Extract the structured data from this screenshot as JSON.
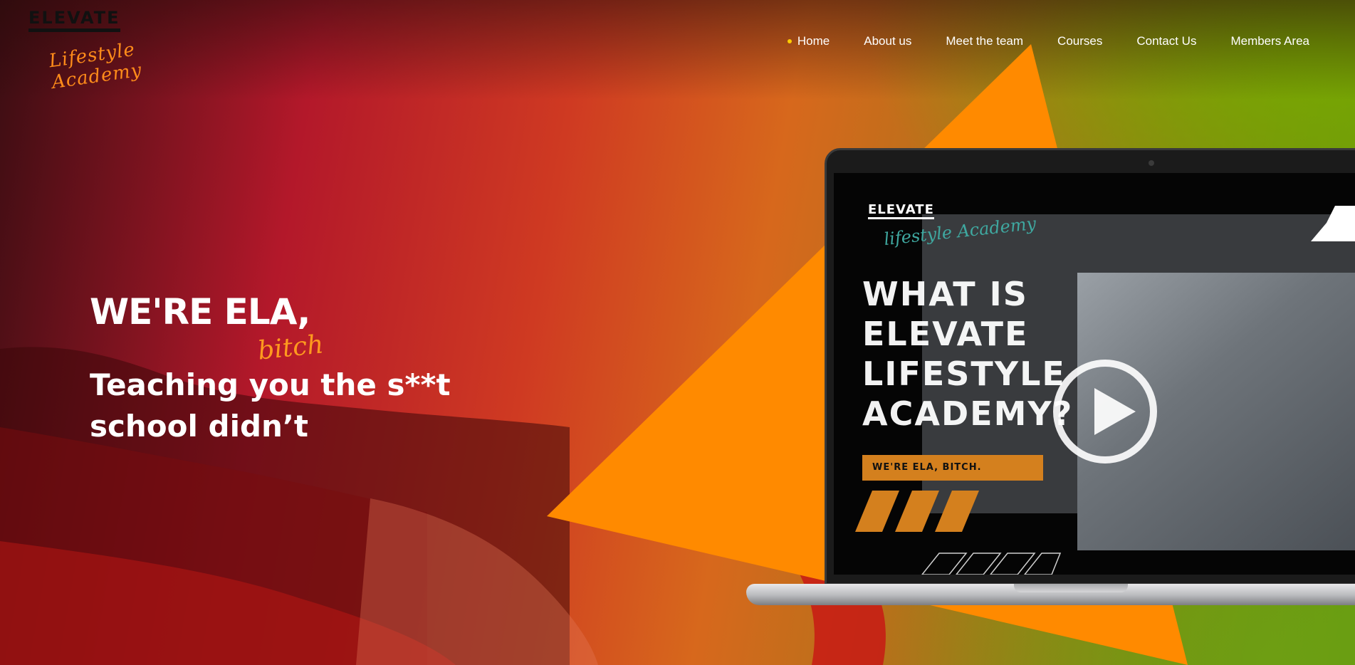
{
  "logo": {
    "wordmark": "ELEVATE",
    "script": "Lifestyle Academy"
  },
  "nav": {
    "items": [
      {
        "label": "Home",
        "active": true
      },
      {
        "label": "About us",
        "active": false
      },
      {
        "label": "Meet the team",
        "active": false
      },
      {
        "label": "Courses",
        "active": false
      },
      {
        "label": "Contact Us",
        "active": false
      },
      {
        "label": "Members Area",
        "active": false
      }
    ]
  },
  "hero": {
    "headline": "WE'RE ELA,",
    "script": "bitch",
    "subline_1": "Teaching you the s**t",
    "subline_2": "school didn’t"
  },
  "video": {
    "logo_word": "ELEVATE",
    "logo_script": "lifestyle Academy",
    "title_1": "WHAT IS",
    "title_2": "ELEVATE",
    "title_3": "LIFESTYLE",
    "title_4": "ACADEMY?",
    "tag": "WE'RE ELA, BITCH."
  },
  "colors": {
    "accent_orange": "#ff8a00",
    "nav_active_dot": "#ffcc00"
  }
}
